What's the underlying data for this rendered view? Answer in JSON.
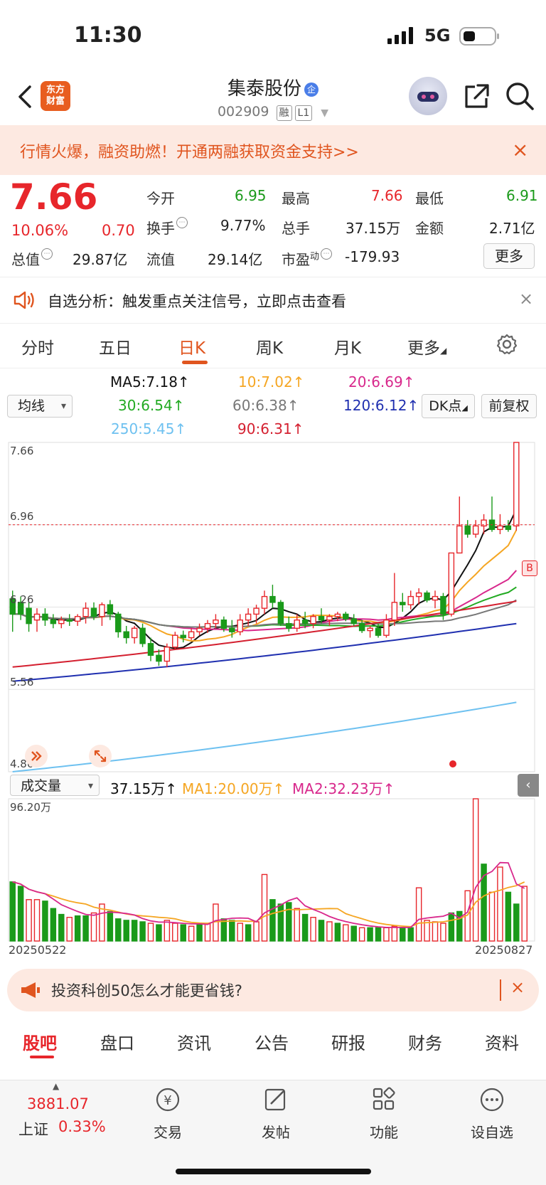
{
  "status": {
    "time": "11:30",
    "network": "5G"
  },
  "header": {
    "logo_text_1": "东方",
    "logo_text_2": "财富",
    "stock_name": "集泰股份",
    "name_badge": "企",
    "stock_code": "002909",
    "tag_margin": "融",
    "tag_level": "L1"
  },
  "promo": {
    "text": "行情火爆，融资助燃！开通两融获取资金支持>>",
    "close": "×"
  },
  "quote": {
    "price": "7.66",
    "change_pct": "10.06%",
    "change": "0.70",
    "open_label": "今开",
    "open": "6.95",
    "high_label": "最高",
    "high": "7.66",
    "low_label": "最低",
    "low": "6.91",
    "turnover_label": "换手",
    "turnover": "9.77%",
    "volume_label": "总手",
    "volume": "37.15万",
    "amount_label": "金额",
    "amount": "2.71亿",
    "mktcap_label": "总值",
    "mktcap": "29.87亿",
    "float_label": "流值",
    "float_cap": "29.14亿",
    "pe_label": "市盈",
    "pe_sup": "动",
    "pe": "-179.93",
    "more": "更多"
  },
  "alert": {
    "text": "自选分析：触发重点关注信号，立即点击查看",
    "close": "×"
  },
  "tabs": [
    {
      "label": "分时"
    },
    {
      "label": "五日"
    },
    {
      "label": "日K"
    },
    {
      "label": "周K"
    },
    {
      "label": "月K"
    },
    {
      "label": "更多"
    }
  ],
  "ma_legend": {
    "ma5": "MA5:7.18↑",
    "ma10": "10:7.02↑",
    "ma20": "20:6.69↑",
    "ma30": "30:6.54↑",
    "ma60": "60:6.38↑",
    "ma120": "120:6.12↑",
    "ma250": "250:5.45↑",
    "ma90": "90:6.31↑"
  },
  "controls": {
    "ma_select": "均线",
    "dk": "DK点",
    "adjust": "前复权",
    "vol_select": "成交量"
  },
  "axis": {
    "p1": "7.66",
    "p2": "6.96",
    "p3": "6.26",
    "p4": "5.56",
    "p5": "4.86",
    "vol_max": "96.20万",
    "date_start": "20250522",
    "date_end": "20250827",
    "b_mark": "B"
  },
  "vol_legend": {
    "vol": "37.15万↑",
    "ma1": "MA1:20.00万↑",
    "ma2": "MA2:32.23万↑"
  },
  "colors": {
    "up": "#e7262b",
    "down": "#1a9a1a",
    "accent": "#e0551f",
    "ma5": "#111111",
    "ma10": "#f5a623",
    "ma20": "#d8288c",
    "ma30": "#22aa22",
    "ma60": "#777777",
    "ma90": "#d42030",
    "ma120": "#2030b0",
    "ma250": "#6ec1f0"
  },
  "bottom_promo": {
    "text": "投资科创50怎么才能更省钱?",
    "close": "×"
  },
  "bottom_tabs": [
    {
      "label": "股吧"
    },
    {
      "label": "盘口"
    },
    {
      "label": "资讯"
    },
    {
      "label": "公告"
    },
    {
      "label": "研报"
    },
    {
      "label": "财务"
    },
    {
      "label": "资料"
    }
  ],
  "nav": {
    "index_value": "3881.07",
    "index_name": "上证",
    "index_pct": "0.33%",
    "trade": "交易",
    "post": "发帖",
    "func": "功能",
    "watch": "设自选"
  },
  "chart_data": {
    "type": "candlestick",
    "x_start": "20250522",
    "x_end": "20250827",
    "ylim": [
      4.86,
      7.66
    ],
    "candles": [
      [
        6.33,
        6.4,
        6.05,
        6.2
      ],
      [
        6.3,
        6.35,
        6.15,
        6.2
      ],
      [
        6.25,
        6.3,
        6.05,
        6.12
      ],
      [
        6.15,
        6.25,
        6.05,
        6.2
      ],
      [
        6.2,
        6.25,
        6.1,
        6.15
      ],
      [
        6.15,
        6.2,
        6.08,
        6.12
      ],
      [
        6.12,
        6.18,
        6.08,
        6.15
      ],
      [
        6.15,
        6.2,
        6.1,
        6.14
      ],
      [
        6.14,
        6.2,
        6.1,
        6.18
      ],
      [
        6.18,
        6.3,
        6.12,
        6.25
      ],
      [
        6.25,
        6.3,
        6.15,
        6.18
      ],
      [
        6.18,
        6.3,
        6.1,
        6.28
      ],
      [
        6.28,
        6.32,
        6.15,
        6.2
      ],
      [
        6.2,
        6.22,
        6.0,
        6.05
      ],
      [
        6.05,
        6.1,
        5.95,
        6.0
      ],
      [
        6.0,
        6.1,
        5.95,
        6.08
      ],
      [
        6.08,
        6.12,
        5.92,
        5.95
      ],
      [
        5.95,
        6.0,
        5.8,
        5.85
      ],
      [
        5.85,
        5.9,
        5.76,
        5.8
      ],
      [
        5.8,
        5.95,
        5.75,
        5.92
      ],
      [
        5.92,
        6.05,
        5.9,
        6.02
      ],
      [
        6.02,
        6.06,
        5.96,
        6.0
      ],
      [
        6.0,
        6.08,
        5.98,
        6.05
      ],
      [
        6.05,
        6.12,
        6.02,
        6.08
      ],
      [
        6.08,
        6.15,
        6.04,
        6.12
      ],
      [
        6.12,
        6.2,
        6.08,
        6.15
      ],
      [
        6.15,
        6.18,
        6.05,
        6.08
      ],
      [
        6.08,
        6.15,
        6.0,
        6.05
      ],
      [
        6.05,
        6.2,
        6.02,
        6.15
      ],
      [
        6.15,
        6.25,
        6.1,
        6.2
      ],
      [
        6.2,
        6.28,
        6.12,
        6.25
      ],
      [
        6.25,
        6.4,
        6.2,
        6.35
      ],
      [
        6.35,
        6.45,
        6.25,
        6.3
      ],
      [
        6.3,
        6.32,
        6.1,
        6.12
      ],
      [
        6.12,
        6.18,
        6.05,
        6.08
      ],
      [
        6.08,
        6.2,
        6.05,
        6.15
      ],
      [
        6.15,
        6.22,
        6.08,
        6.12
      ],
      [
        6.12,
        6.2,
        6.08,
        6.18
      ],
      [
        6.18,
        6.25,
        6.12,
        6.15
      ],
      [
        6.15,
        6.2,
        6.1,
        6.18
      ],
      [
        6.18,
        6.22,
        6.14,
        6.2
      ],
      [
        6.2,
        6.22,
        6.14,
        6.16
      ],
      [
        6.16,
        6.2,
        6.1,
        6.12
      ],
      [
        6.12,
        6.15,
        6.04,
        6.06
      ],
      [
        6.06,
        6.1,
        6.0,
        6.08
      ],
      [
        6.08,
        6.12,
        6.0,
        6.02
      ],
      [
        6.02,
        6.2,
        6.0,
        6.15
      ],
      [
        6.15,
        6.55,
        6.1,
        6.3
      ],
      [
        6.3,
        6.38,
        6.22,
        6.28
      ],
      [
        6.28,
        6.4,
        6.24,
        6.35
      ],
      [
        6.35,
        6.42,
        6.28,
        6.38
      ],
      [
        6.38,
        6.4,
        6.3,
        6.32
      ],
      [
        6.32,
        6.4,
        6.25,
        6.35
      ],
      [
        6.35,
        6.38,
        6.15,
        6.2
      ],
      [
        6.2,
        6.72,
        6.18,
        6.72
      ],
      [
        6.72,
        7.2,
        6.75,
        6.95
      ],
      [
        6.95,
        7.0,
        6.85,
        6.88
      ],
      [
        6.88,
        7.0,
        6.85,
        6.95
      ],
      [
        6.95,
        7.05,
        6.88,
        7.0
      ],
      [
        7.0,
        7.2,
        6.9,
        6.92
      ],
      [
        6.92,
        7.05,
        6.88,
        6.95
      ],
      [
        6.95,
        7.0,
        6.9,
        6.92
      ],
      [
        6.95,
        7.66,
        6.91,
        7.66
      ]
    ],
    "volume_max": 96.2,
    "volumes": [
      [
        40,
        0
      ],
      [
        37,
        0
      ],
      [
        28,
        1
      ],
      [
        28,
        1
      ],
      [
        27,
        0
      ],
      [
        22,
        0
      ],
      [
        18,
        0
      ],
      [
        16,
        1
      ],
      [
        17,
        0
      ],
      [
        17,
        0
      ],
      [
        19,
        1
      ],
      [
        25,
        1
      ],
      [
        20,
        0
      ],
      [
        15,
        0
      ],
      [
        14,
        0
      ],
      [
        14,
        0
      ],
      [
        13,
        0
      ],
      [
        12,
        1
      ],
      [
        11,
        0
      ],
      [
        14,
        1
      ],
      [
        12,
        1
      ],
      [
        11,
        0
      ],
      [
        10,
        1
      ],
      [
        11,
        0
      ],
      [
        12,
        1
      ],
      [
        25,
        1
      ],
      [
        15,
        0
      ],
      [
        14,
        0
      ],
      [
        12,
        1
      ],
      [
        11,
        0
      ],
      [
        13,
        1
      ],
      [
        45,
        1
      ],
      [
        28,
        0
      ],
      [
        25,
        0
      ],
      [
        26,
        0
      ],
      [
        22,
        1
      ],
      [
        18,
        0
      ],
      [
        16,
        1
      ],
      [
        14,
        0
      ],
      [
        13,
        1
      ],
      [
        12,
        0
      ],
      [
        11,
        1
      ],
      [
        10,
        0
      ],
      [
        9,
        1
      ],
      [
        9,
        0
      ],
      [
        9,
        0
      ],
      [
        9,
        1
      ],
      [
        10,
        1
      ],
      [
        9,
        0
      ],
      [
        9,
        0
      ],
      [
        36,
        1
      ],
      [
        14,
        1
      ],
      [
        13,
        1
      ],
      [
        12,
        1
      ],
      [
        19,
        0
      ],
      [
        20,
        0
      ],
      [
        34,
        1
      ],
      [
        96.2,
        1
      ],
      [
        52,
        0
      ],
      [
        33,
        1
      ],
      [
        50,
        1
      ],
      [
        33,
        0
      ],
      [
        25,
        0
      ],
      [
        37,
        1
      ]
    ]
  }
}
